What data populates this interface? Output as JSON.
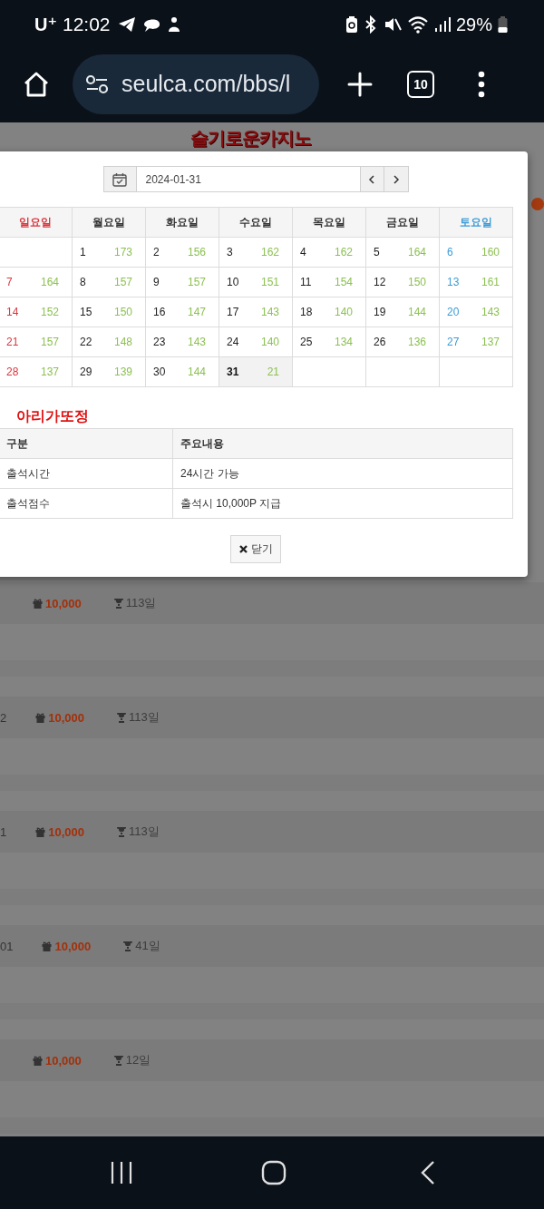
{
  "status_bar": {
    "carrier": "U⁺",
    "time": "12:02",
    "battery": "29%"
  },
  "browser": {
    "url": "seulca.com/bbs/l",
    "tab_count": "10"
  },
  "page": {
    "logo": "슬기로운카지노",
    "rows": [
      {
        "points": "10,000",
        "days": "113일"
      },
      {
        "column_1": "2",
        "points": "10,000",
        "days": "113일"
      },
      {
        "column_1": "1",
        "points": "10,000",
        "days": "113일"
      },
      {
        "column_1": "01",
        "points": "10,000",
        "days": "41일"
      },
      {
        "points": "10,000",
        "days": "12일"
      }
    ]
  },
  "modal": {
    "date": "2024-01-31",
    "calendar": {
      "weekdays": [
        {
          "label": "일요일",
          "kind": "sunday"
        },
        {
          "label": "월요일",
          "kind": "weekday"
        },
        {
          "label": "화요일",
          "kind": "weekday"
        },
        {
          "label": "수요일",
          "kind": "weekday"
        },
        {
          "label": "목요일",
          "kind": "weekday"
        },
        {
          "label": "금요일",
          "kind": "weekday"
        },
        {
          "label": "토요일",
          "kind": "saturday"
        }
      ],
      "weeks": [
        [
          {
            "kind": "blank"
          },
          {
            "kind": "day",
            "day": "1",
            "count": "173",
            "selected": false
          },
          {
            "kind": "day",
            "day": "2",
            "count": "156",
            "selected": false
          },
          {
            "kind": "day",
            "day": "3",
            "count": "162",
            "selected": false
          },
          {
            "kind": "day",
            "day": "4",
            "count": "162",
            "selected": false
          },
          {
            "kind": "day",
            "day": "5",
            "count": "164",
            "selected": false
          },
          {
            "kind": "day",
            "day": "6",
            "count": "160",
            "selected": false
          }
        ],
        [
          {
            "kind": "day",
            "day": "7",
            "count": "164",
            "selected": false
          },
          {
            "kind": "day",
            "day": "8",
            "count": "157",
            "selected": false
          },
          {
            "kind": "day",
            "day": "9",
            "count": "157",
            "selected": false
          },
          {
            "kind": "day",
            "day": "10",
            "count": "151",
            "selected": false
          },
          {
            "kind": "day",
            "day": "11",
            "count": "154",
            "selected": false
          },
          {
            "kind": "day",
            "day": "12",
            "count": "150",
            "selected": false
          },
          {
            "kind": "day",
            "day": "13",
            "count": "161",
            "selected": false
          }
        ],
        [
          {
            "kind": "day",
            "day": "14",
            "count": "152",
            "selected": false
          },
          {
            "kind": "day",
            "day": "15",
            "count": "150",
            "selected": false
          },
          {
            "kind": "day",
            "day": "16",
            "count": "147",
            "selected": false
          },
          {
            "kind": "day",
            "day": "17",
            "count": "143",
            "selected": false
          },
          {
            "kind": "day",
            "day": "18",
            "count": "140",
            "selected": false
          },
          {
            "kind": "day",
            "day": "19",
            "count": "144",
            "selected": false
          },
          {
            "kind": "day",
            "day": "20",
            "count": "143",
            "selected": false
          }
        ],
        [
          {
            "kind": "day",
            "day": "21",
            "count": "157",
            "selected": false
          },
          {
            "kind": "day",
            "day": "22",
            "count": "148",
            "selected": false
          },
          {
            "kind": "day",
            "day": "23",
            "count": "143",
            "selected": false
          },
          {
            "kind": "day",
            "day": "24",
            "count": "140",
            "selected": false
          },
          {
            "kind": "day",
            "day": "25",
            "count": "134",
            "selected": false
          },
          {
            "kind": "day",
            "day": "26",
            "count": "136",
            "selected": false
          },
          {
            "kind": "day",
            "day": "27",
            "count": "137",
            "selected": false
          }
        ],
        [
          {
            "kind": "day",
            "day": "28",
            "count": "137",
            "selected": false
          },
          {
            "kind": "day",
            "day": "29",
            "count": "139",
            "selected": false
          },
          {
            "kind": "day",
            "day": "30",
            "count": "144",
            "selected": false
          },
          {
            "kind": "day",
            "day": "31",
            "count": "21",
            "selected": true
          },
          {
            "kind": "blank"
          },
          {
            "kind": "blank"
          },
          {
            "kind": "blank"
          }
        ]
      ]
    },
    "info": {
      "title": "아리가또정",
      "columns": [
        "구분",
        "주요내용"
      ],
      "rows": [
        [
          "출석시간",
          "24시간 가능"
        ],
        [
          "출석점수",
          "출석시 10,000P 지급"
        ]
      ]
    },
    "close_button": "닫기"
  }
}
